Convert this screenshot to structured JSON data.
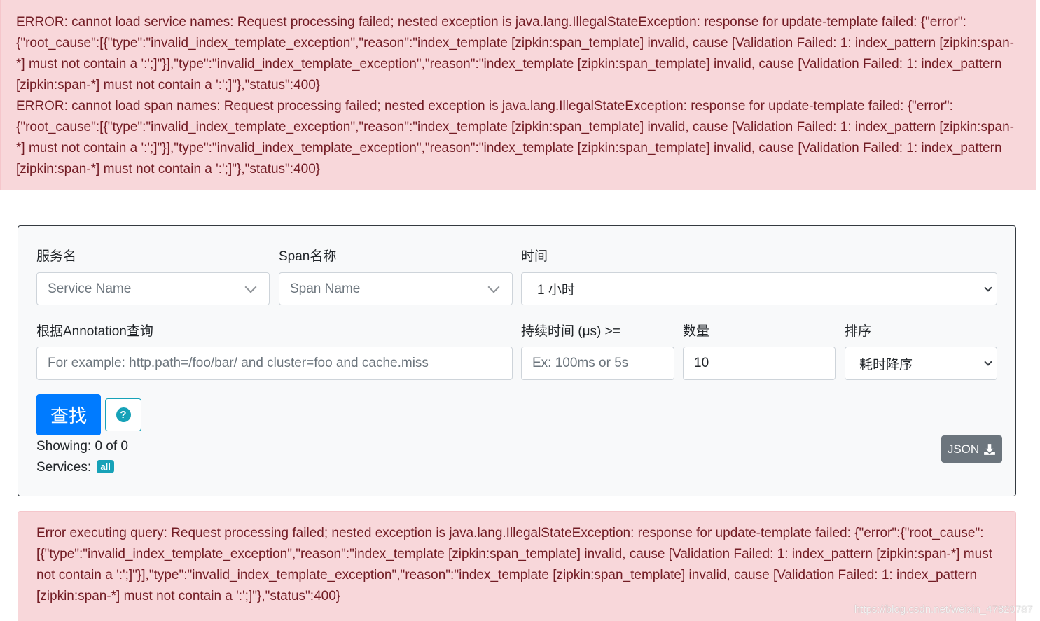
{
  "errors_top": [
    "ERROR: cannot load service names: Request processing failed; nested exception is java.lang.IllegalStateException: response for update-template failed: {\"error\":{\"root_cause\":[{\"type\":\"invalid_index_template_exception\",\"reason\":\"index_template [zipkin:span_template] invalid, cause [Validation Failed: 1: index_pattern [zipkin:span-*] must not contain a ':';]\"}],\"type\":\"invalid_index_template_exception\",\"reason\":\"index_template [zipkin:span_template] invalid, cause [Validation Failed: 1: index_pattern [zipkin:span-*] must not contain a ':';]\"},\"status\":400}",
    "ERROR: cannot load span names: Request processing failed; nested exception is java.lang.IllegalStateException: response for update-template failed: {\"error\":{\"root_cause\":[{\"type\":\"invalid_index_template_exception\",\"reason\":\"index_template [zipkin:span_template] invalid, cause [Validation Failed: 1: index_pattern [zipkin:span-*] must not contain a ':';]\"}],\"type\":\"invalid_index_template_exception\",\"reason\":\"index_template [zipkin:span_template] invalid, cause [Validation Failed: 1: index_pattern [zipkin:span-*] must not contain a ':';]\"},\"status\":400}"
  ],
  "form": {
    "service_label": "服务名",
    "service_placeholder": "Service Name",
    "span_label": "Span名称",
    "span_placeholder": "Span Name",
    "time_label": "时间",
    "time_value": "1 小时",
    "annotation_label": "根据Annotation查询",
    "annotation_placeholder": "For example: http.path=/foo/bar/ and cluster=foo and cache.miss",
    "duration_label": "持续时间 (μs) >=",
    "duration_placeholder": "Ex: 100ms or 5s",
    "limit_label": "数量",
    "limit_value": "10",
    "sort_label": "排序",
    "sort_value": "耗时降序",
    "find_label": "查找",
    "help_icon": "question-circle-icon"
  },
  "results": {
    "showing_text": "Showing: 0 of 0",
    "services_label": "Services:",
    "services_badge": "all",
    "json_label": "JSON",
    "json_icon": "download-icon"
  },
  "error_bottom": "Error executing query: Request processing failed; nested exception is java.lang.IllegalStateException: response for update-template failed: {\"error\":{\"root_cause\":[{\"type\":\"invalid_index_template_exception\",\"reason\":\"index_template [zipkin:span_template] invalid, cause [Validation Failed: 1: index_pattern [zipkin:span-*] must not contain a ':';]\"}],\"type\":\"invalid_index_template_exception\",\"reason\":\"index_template [zipkin:span_template] invalid, cause [Validation Failed: 1: index_pattern [zipkin:span-*] must not contain a ':';]\"},\"status\":400}",
  "watermark": "https://blog.csdn.net/weixin_47820787",
  "colors": {
    "danger_bg": "#f8d7da",
    "danger_text": "#721c24",
    "primary": "#007bff",
    "info": "#17a2b8",
    "secondary": "#6c757d"
  }
}
